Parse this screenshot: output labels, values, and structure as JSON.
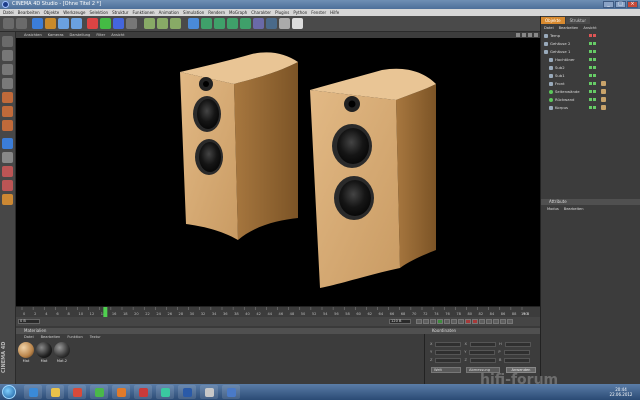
{
  "window": {
    "title": "CINEMA 4D Studio - [Ohne Titel 2 *]"
  },
  "menubar": [
    "Datei",
    "Bearbeiten",
    "Objekte",
    "Werkzeuge",
    "Selektion",
    "Struktur",
    "Funktionen",
    "Animation",
    "Simulation",
    "Rendern",
    "MoGraph",
    "Charakter",
    "Plugins",
    "Python",
    "Fenster",
    "Hilfe"
  ],
  "viewport": {
    "menu": [
      "Ansichten",
      "Kameras",
      "Darstellung",
      "Filter",
      "Ansicht"
    ]
  },
  "timeline": {
    "ticks": [
      "0",
      "2",
      "4",
      "6",
      "8",
      "10",
      "12",
      "14",
      "16",
      "18",
      "20",
      "22",
      "24",
      "26",
      "28",
      "30",
      "32",
      "34",
      "36",
      "38",
      "40",
      "42",
      "44",
      "46",
      "48",
      "50",
      "52",
      "54",
      "56",
      "58",
      "60",
      "62",
      "64",
      "66",
      "68",
      "70",
      "72",
      "74",
      "76",
      "78",
      "80",
      "82",
      "84",
      "86",
      "88",
      "90"
    ],
    "current_frame": "15",
    "end_label": "15 B",
    "frame_start": "0 B",
    "frame_end": "120 B"
  },
  "materials": {
    "title": "Materialien",
    "menu": [
      "Datei",
      "Bearbeiten",
      "Funktion",
      "Textur"
    ],
    "items": [
      {
        "label": "Mat"
      },
      {
        "label": "Mat"
      },
      {
        "label": "Mat.2"
      }
    ]
  },
  "coordinates": {
    "title": "Koordinaten",
    "rows": [
      {
        "a": "X",
        "b": "X",
        "c": "H"
      },
      {
        "a": "Y",
        "b": "Y",
        "c": "P"
      },
      {
        "a": "Z",
        "b": "Z",
        "c": "B"
      }
    ],
    "mode": "Welt",
    "size_mode": "Abmessung",
    "apply": "Anwenden"
  },
  "object_manager": {
    "tabs": [
      "Objekte",
      "Struktur"
    ],
    "menu": [
      "Datei",
      "Bearbeiten",
      "Ansicht"
    ],
    "objects": [
      {
        "name": "Temp",
        "icon": "null-icon"
      },
      {
        "name": "Gehäuse 2",
        "icon": "symmetry-icon"
      },
      {
        "name": "Gehäuse 1",
        "icon": "null-icon"
      },
      {
        "name": "Hochtöner",
        "icon": "null-icon"
      },
      {
        "name": "Sub2",
        "icon": "null-icon"
      },
      {
        "name": "Sub1",
        "icon": "null-icon"
      },
      {
        "name": "Front",
        "icon": "null-icon"
      },
      {
        "name": "Seitenwände",
        "icon": "sphere-icon"
      },
      {
        "name": "Rückwand",
        "icon": "sphere-icon"
      },
      {
        "name": "Korpus",
        "icon": "null-icon"
      }
    ]
  },
  "attribute_manager": {
    "title": "Attribute",
    "menu": [
      "Modus",
      "Bearbeiten"
    ]
  },
  "taskbar": {
    "time": "20:44",
    "date": "22.06.2012",
    "watermark": "hifi-forum"
  }
}
